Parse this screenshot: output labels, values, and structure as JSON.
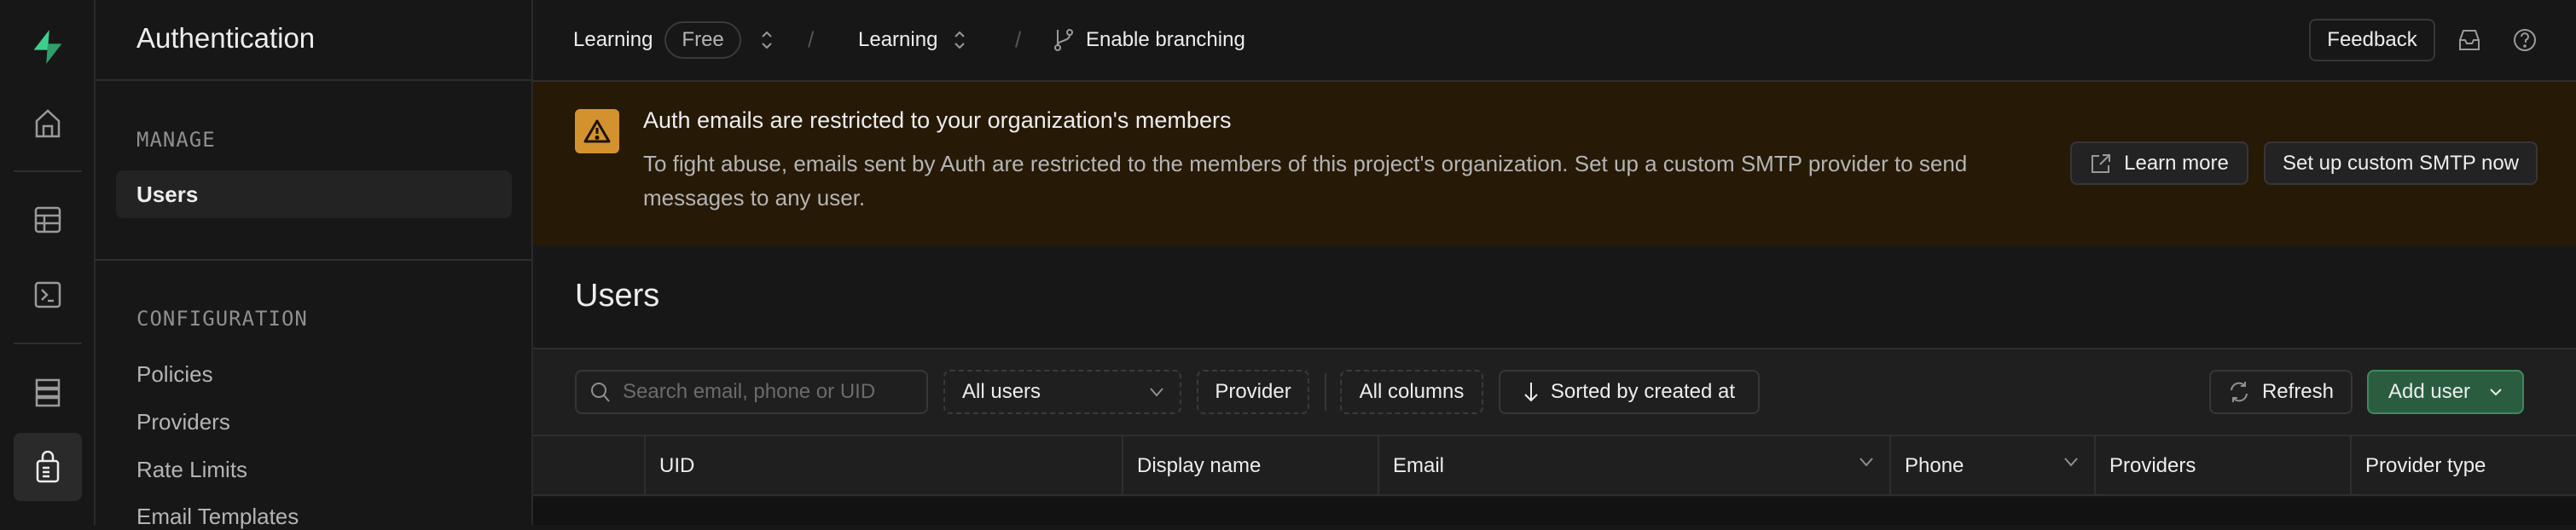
{
  "rail": {
    "items": [
      {
        "icon": "logo-bolt-icon"
      },
      {
        "icon": "home-icon"
      },
      {
        "icon": "table-editor-icon"
      },
      {
        "icon": "sql-terminal-icon"
      },
      {
        "icon": "database-icon"
      },
      {
        "icon": "authentication-lock-icon",
        "active": true
      }
    ],
    "brand_color": "#3ecf8e"
  },
  "sidebar": {
    "title": "Authentication",
    "sections": [
      {
        "label": "MANAGE",
        "items": [
          {
            "label": "Users",
            "active": true
          }
        ]
      },
      {
        "label": "CONFIGURATION",
        "items": [
          {
            "label": "Policies"
          },
          {
            "label": "Providers"
          },
          {
            "label": "Rate Limits"
          },
          {
            "label": "Email Templates"
          }
        ]
      }
    ]
  },
  "topbar": {
    "org": "Learning",
    "plan": "Free",
    "project": "Learning",
    "branching": "Enable branching",
    "feedback": "Feedback"
  },
  "banner": {
    "title": "Auth emails are restricted to your organization's members",
    "body": "To fight abuse, emails sent by Auth are restricted to the members of this project's organization. Set up a custom SMTP provider to send messages to any user.",
    "learn_more": "Learn more",
    "setup": "Set up custom SMTP now",
    "warning_color": "#d4922f"
  },
  "page": {
    "title": "Users"
  },
  "toolbar": {
    "search_placeholder": "Search email, phone or UID",
    "filter": "All users",
    "provider": "Provider",
    "columns": "All columns",
    "sort": "Sorted by created at",
    "refresh": "Refresh",
    "add_user": "Add user",
    "accent": "#2a5d3f"
  },
  "table": {
    "columns": [
      "UID",
      "Display name",
      "Email",
      "Phone",
      "Providers",
      "Provider type"
    ]
  }
}
